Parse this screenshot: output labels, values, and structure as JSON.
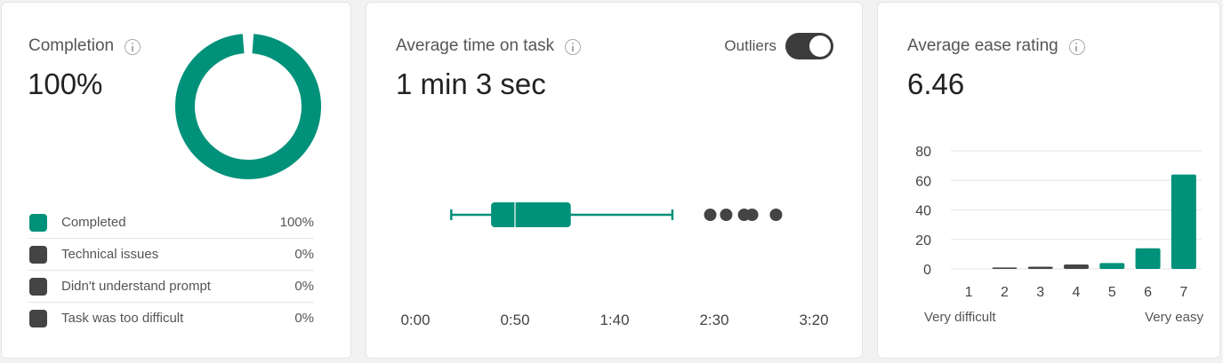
{
  "colors": {
    "accent": "#00917a",
    "dark": "#444444",
    "grid": "#e6e6e6",
    "axis": "#555555"
  },
  "completion": {
    "title": "Completion",
    "value": "100%",
    "legend": [
      {
        "label": "Completed",
        "pct": "100%",
        "color": "#00917a"
      },
      {
        "label": "Technical issues",
        "pct": "0%",
        "color": "#444444"
      },
      {
        "label": "Didn't understand prompt",
        "pct": "0%",
        "color": "#444444"
      },
      {
        "label": "Task was too difficult",
        "pct": "0%",
        "color": "#444444"
      }
    ]
  },
  "time": {
    "title": "Average time on task",
    "value": "1 min 3 sec",
    "toggle_label": "Outliers",
    "toggle_on": true
  },
  "ease": {
    "title": "Average ease rating",
    "value": "6.46",
    "low_label": "Very difficult",
    "high_label": "Very easy"
  },
  "chart_data": [
    {
      "type": "pie",
      "title": "Completion",
      "categories": [
        "Completed",
        "Technical issues",
        "Didn't understand prompt",
        "Task was too difficult"
      ],
      "values": [
        100,
        0,
        0,
        0
      ],
      "style": "donut"
    },
    {
      "type": "box",
      "title": "Average time on task",
      "xlim": [
        0,
        200
      ],
      "ticks": [
        0,
        50,
        100,
        150,
        200
      ],
      "tick_labels": [
        "0:00",
        "0:50",
        "1:40",
        "2:30",
        "3:20"
      ],
      "whisker_low": 18,
      "q1": 38,
      "median": 50,
      "q3": 78,
      "whisker_high": 129,
      "outliers": [
        148,
        156,
        165,
        169,
        181
      ]
    },
    {
      "type": "bar",
      "title": "Average ease rating",
      "categories": [
        "1",
        "2",
        "3",
        "4",
        "5",
        "6",
        "7"
      ],
      "values": [
        0,
        1,
        1.5,
        3,
        4,
        14,
        64
      ],
      "ylim": [
        0,
        80
      ],
      "yticks": [
        0,
        20,
        40,
        60,
        80
      ],
      "bar_colors": [
        "#444444",
        "#444444",
        "#444444",
        "#444444",
        "#00917a",
        "#00917a",
        "#00917a"
      ]
    }
  ]
}
